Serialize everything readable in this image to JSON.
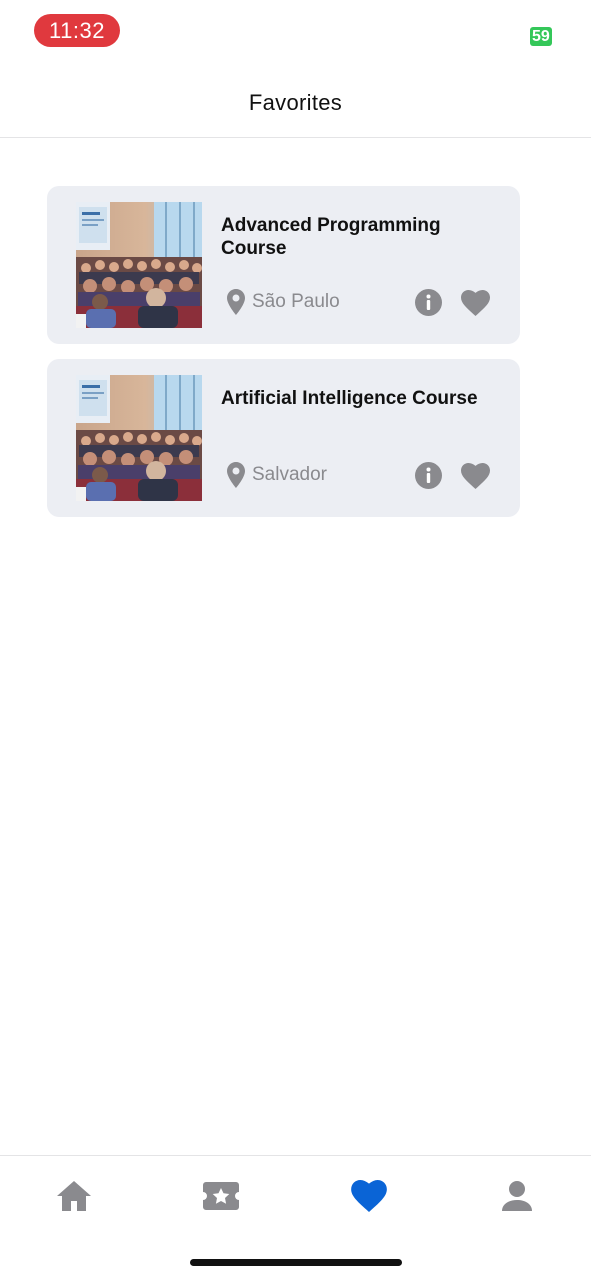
{
  "status_bar": {
    "time": "11:32",
    "battery": "59"
  },
  "header": {
    "title": "Favorites"
  },
  "favorites": [
    {
      "title": "Advanced Programming Course",
      "location": "São Paulo"
    },
    {
      "title": "Artificial Intelligence Course",
      "location": "Salvador"
    }
  ],
  "tab_bar": {
    "active_tab": "favorites",
    "tabs": [
      {
        "icon": "home-icon"
      },
      {
        "icon": "ticket-star-icon"
      },
      {
        "icon": "heart-icon"
      },
      {
        "icon": "person-icon"
      }
    ]
  },
  "colors": {
    "accent": "#0a64d6",
    "icon_gray": "#8a8a8e",
    "card_bg": "#eceef3",
    "time_pill": "#e0393e",
    "battery": "#34c759"
  }
}
